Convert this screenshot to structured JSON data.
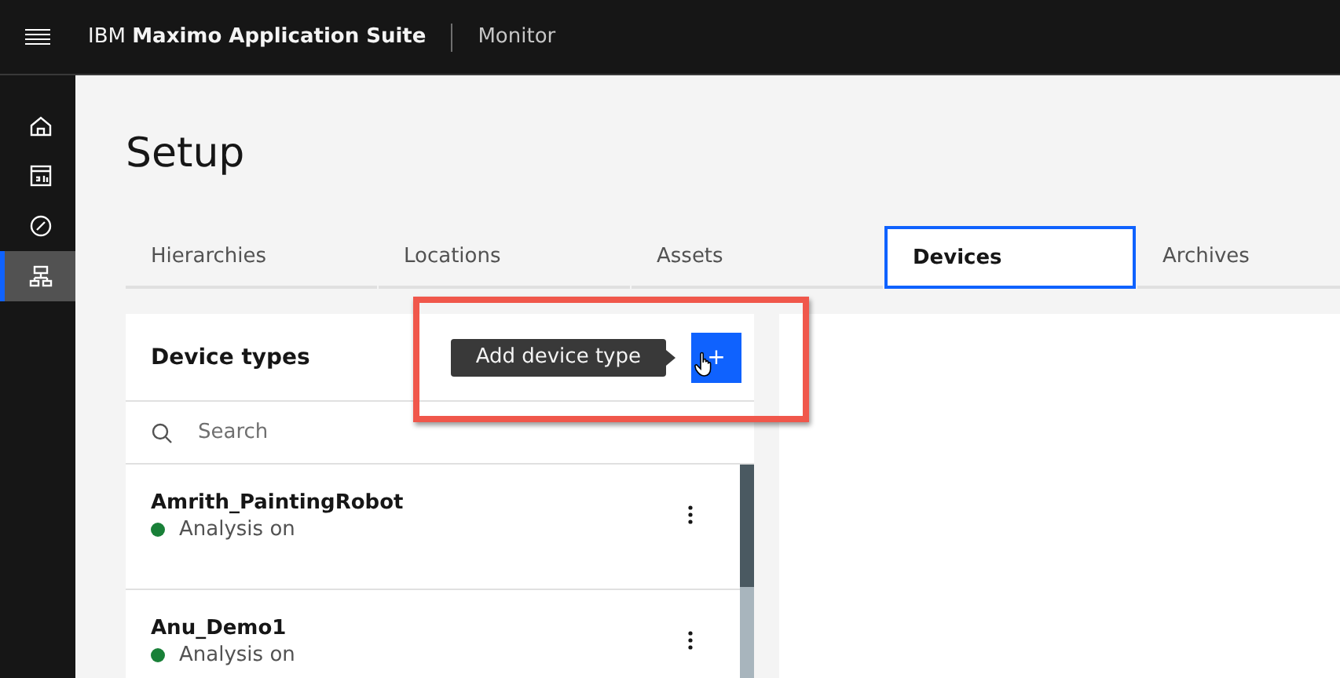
{
  "header": {
    "brand_prefix": "IBM",
    "brand_name": "Maximo Application Suite",
    "app": "Monitor"
  },
  "sidebar": {
    "items": [
      {
        "selected": false
      },
      {
        "selected": false
      },
      {
        "selected": false
      },
      {
        "selected": true
      }
    ]
  },
  "page": {
    "title": "Setup"
  },
  "tabs": [
    {
      "label": "Hierarchies",
      "selected": false
    },
    {
      "label": "Locations",
      "selected": false
    },
    {
      "label": "Assets",
      "selected": false
    },
    {
      "label": "Devices",
      "selected": true
    },
    {
      "label": "Archives",
      "selected": false
    }
  ],
  "device_types": {
    "title": "Device types",
    "add_tooltip": "Add device type",
    "add_button": "+",
    "search": {
      "placeholder": "Search"
    },
    "items": [
      {
        "name": "Amrith_PaintingRobot",
        "status": "Analysis on",
        "color": "#198038"
      },
      {
        "name": "Anu_Demo1",
        "status": "Analysis on",
        "color": "#198038"
      }
    ]
  }
}
